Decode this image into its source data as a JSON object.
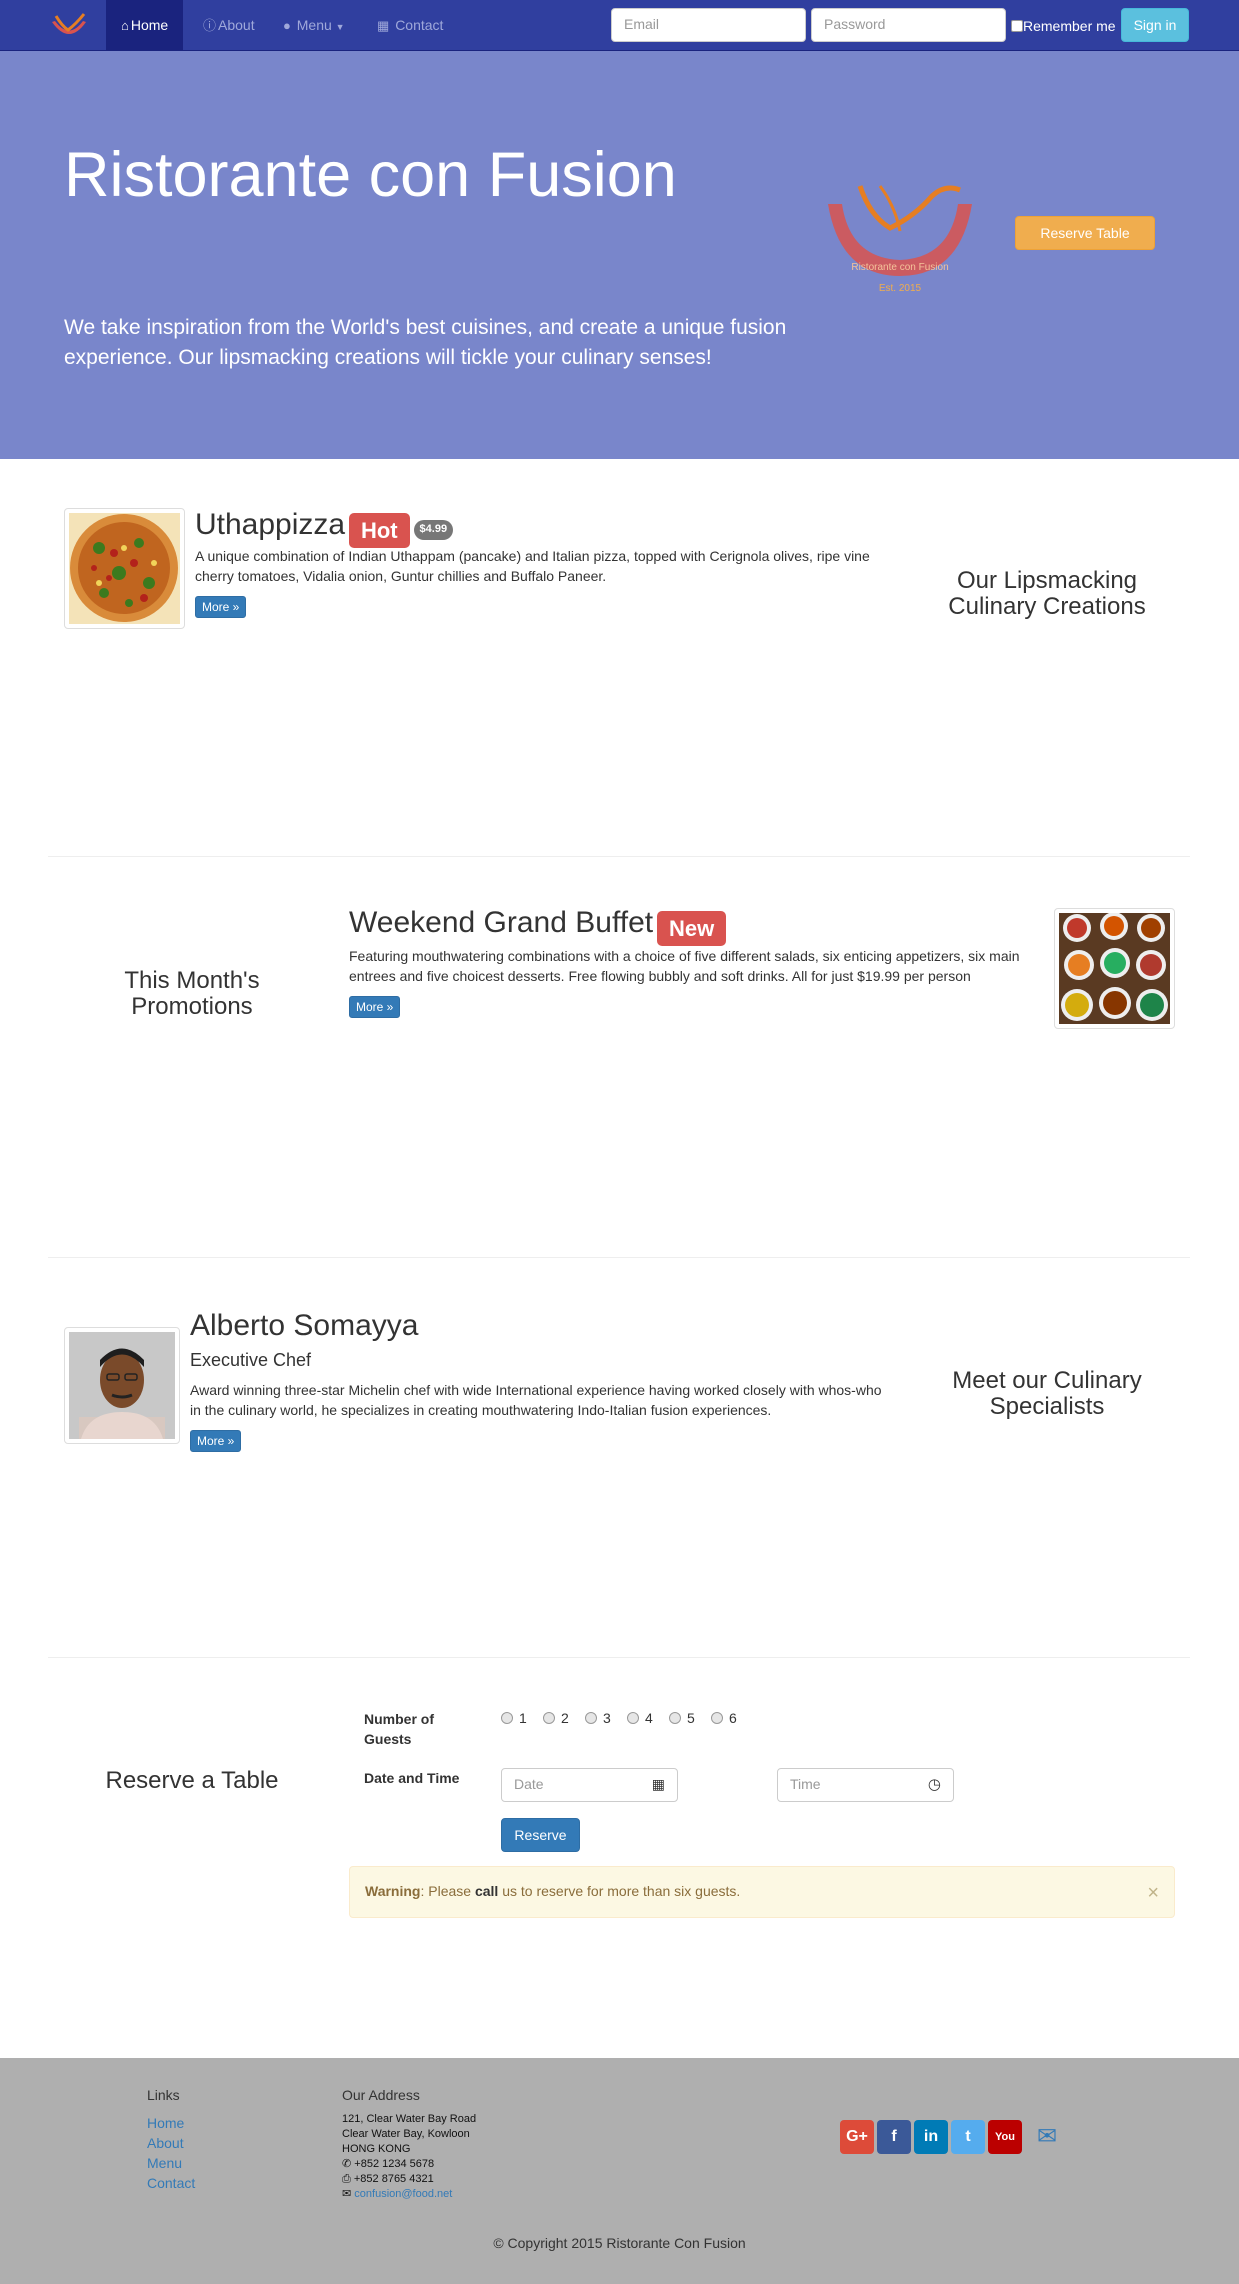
{
  "nav": {
    "items": [
      {
        "label": "Home",
        "icon": "home-icon"
      },
      {
        "label": "About",
        "icon": "info-circle-icon"
      },
      {
        "label": "Menu",
        "icon": "list-icon"
      },
      {
        "label": "Contact",
        "icon": "address-card-icon"
      }
    ],
    "email_placeholder": "Email",
    "password_placeholder": "Password",
    "remember_label": "Remember me",
    "signin_label": "Sign in"
  },
  "jumbotron": {
    "title": "Ristorante con Fusion",
    "text": "We take inspiration from the World's best cuisines, and create a unique fusion experience. Our lipsmacking creations will tickle your culinary senses!",
    "logo_text": "Ristorante con Fusion",
    "logo_est": "Est. 2015",
    "reserve_button": "Reserve Table"
  },
  "dish": {
    "name": "Uthappizza",
    "label": "Hot",
    "price": "$4.99",
    "description": "A unique combination of Indian Uthappam (pancake) and Italian pizza, topped with Cerignola olives, ripe vine cherry tomatoes, Vidalia onion, Guntur chillies and Buffalo Paneer.",
    "more": "More »",
    "side_title": "Our Lipsmacking Culinary Creations"
  },
  "promotion": {
    "name": "Weekend Grand Buffet",
    "label": "New",
    "description": "Featuring mouthwatering combinations with a choice of five different salads, six enticing appetizers, six main entrees and five choicest desserts. Free flowing bubbly and soft drinks. All for just $19.99 per person",
    "more": "More »",
    "side_title": "This Month's Promotions"
  },
  "leader": {
    "name": "Alberto Somayya",
    "role": "Executive Chef",
    "description": "Award winning three-star Michelin chef with wide International experience having worked closely with whos-who in the culinary world, he specializes in creating mouthwatering Indo-Italian fusion experiences.",
    "more": "More »",
    "side_title": "Meet our Culinary Specialists"
  },
  "reserve": {
    "title": "Reserve a Table",
    "guests_label": "Number of Guests",
    "guest_options": [
      "1",
      "2",
      "3",
      "4",
      "5",
      "6"
    ],
    "date_time_label": "Date and Time",
    "date_placeholder": "Date",
    "time_placeholder": "Time",
    "submit": "Reserve",
    "warning_strong": "Warning",
    "warning_pre": ": Please ",
    "warning_call": "call",
    "warning_post": " us to reserve for more than six guests.",
    "close": "×"
  },
  "footer": {
    "links_title": "Links",
    "links": [
      "Home",
      "About",
      "Menu",
      "Contact"
    ],
    "address_title": "Our Address",
    "address_lines": [
      "121, Clear Water Bay Road",
      "Clear Water Bay, Kowloon",
      "HONG KONG"
    ],
    "phone": "+852 1234 5678",
    "fax": "+852 8765 4321",
    "email": "confusion@food.net",
    "social": [
      {
        "name": "google-plus",
        "glyph": "G+",
        "color": "#dd4b39"
      },
      {
        "name": "facebook",
        "glyph": "f",
        "color": "#3b5998"
      },
      {
        "name": "linkedin",
        "glyph": "in",
        "color": "#007bb6"
      },
      {
        "name": "twitter",
        "glyph": "t",
        "color": "#55acee"
      },
      {
        "name": "youtube",
        "glyph": "You",
        "color": "#bb0000"
      }
    ],
    "copyright": "© Copyright 2015 Ristorante Con Fusion"
  }
}
